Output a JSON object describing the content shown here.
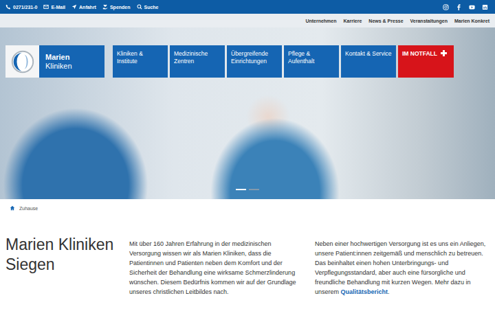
{
  "topbar": {
    "contacts": [
      {
        "label": "0271/231-0"
      },
      {
        "label": "E-Mail"
      },
      {
        "label": "Anfahrt"
      },
      {
        "label": "Spenden"
      },
      {
        "label": "Suche"
      }
    ]
  },
  "meta_nav": [
    "Unternehmen",
    "Karriere",
    "News & Presse",
    "Veranstaltungen",
    "Marien Konkret"
  ],
  "logo": {
    "line1": "Marien",
    "line2": "Kliniken"
  },
  "main_nav": [
    {
      "label": "Kliniken & Institute",
      "kind": "menu"
    },
    {
      "label": "Medizinische Zentren",
      "kind": "menu"
    },
    {
      "label": "Übergreifende Einrichtungen",
      "kind": "menu"
    },
    {
      "label": "Pflege & Aufenthalt",
      "kind": "menu"
    },
    {
      "label": "Kontakt & Service",
      "kind": "menu"
    },
    {
      "label": "IM NOTFALL",
      "kind": "emergency"
    }
  ],
  "slider": [
    {
      "selected": true
    },
    {
      "selected": false
    }
  ],
  "breadcrumb": [
    "Zuhause"
  ],
  "intro": {
    "title": "Marien Kliniken Siegen",
    "paragraph1": "Mit über 160 Jahren Erfahrung in der medizinischen Versorgung wissen wir als Marien Kliniken, dass die Patientinnen und Patienten neben dem Komfort und der Sicherheit der Behandlung eine wirksame Schmerzlinderung wünschen. Diesem Bedürfnis kommen wir auf der Grundlage unseres christlichen Leitbildes nach.",
    "paragraph2": "Neben einer hochwertigen Versorgung ist es uns ein Anliegen, unsere Patient:innen zeitgemäß und menschlich zu betreuen. Das beinhaltet einen hohen Unterbringungs- und Verpflegungsstandard, aber auch eine fürsorgliche und freundliche Behandlung mit kurzen Wegen. Mehr dazu in unserem",
    "link": "Qualitätsbericht",
    "link_after": "."
  }
}
